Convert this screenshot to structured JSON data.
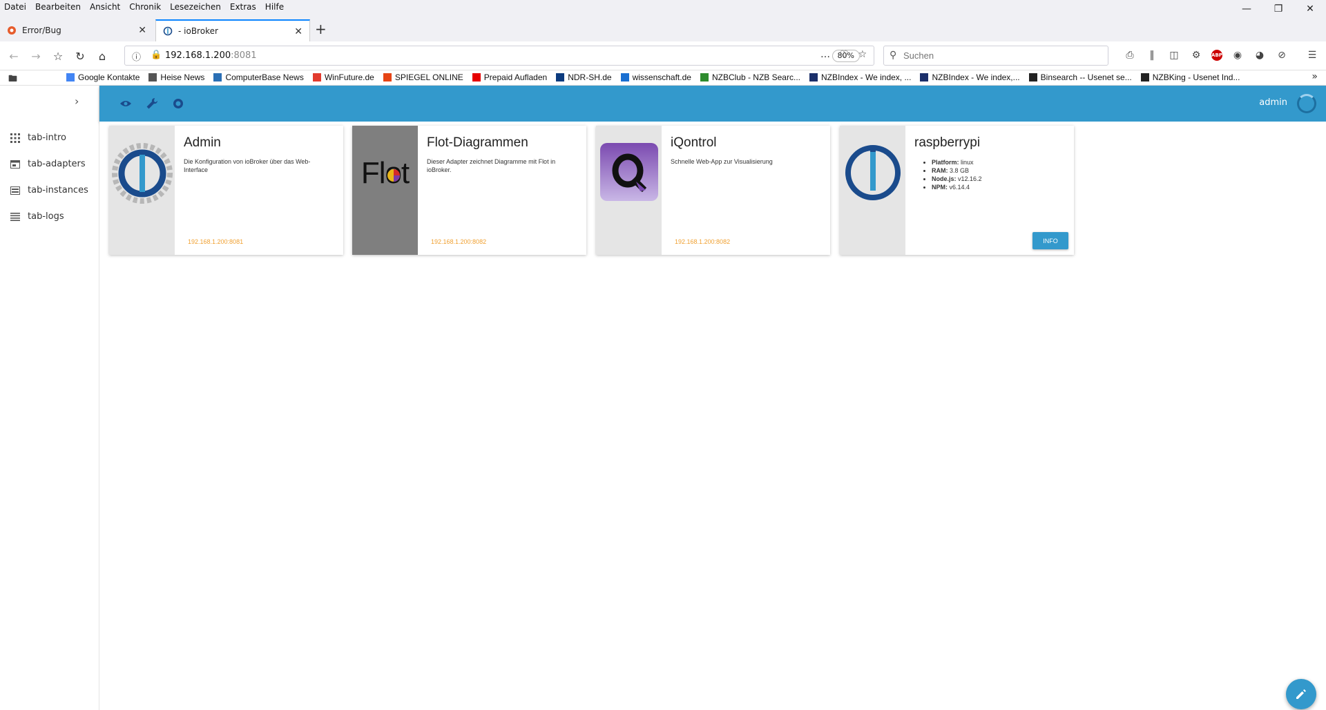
{
  "browser": {
    "menu": [
      "Datei",
      "Bearbeiten",
      "Ansicht",
      "Chronik",
      "Lesezeichen",
      "Extras",
      "Hilfe"
    ],
    "tabs": [
      {
        "label": "Error/Bug",
        "active": false
      },
      {
        "label": "- ioBroker",
        "active": true
      }
    ],
    "url": {
      "host": "192.168.1.200",
      "port": ":8081"
    },
    "zoom": "80%",
    "search_placeholder": "Suchen",
    "bookmarks": [
      {
        "label": "Google Kontakte",
        "icon": "google-icon",
        "color": "#4285f4"
      },
      {
        "label": "Heise News",
        "icon": "heise-icon",
        "color": "#555555"
      },
      {
        "label": "ComputerBase News",
        "icon": "computerbase-icon",
        "color": "#2a6fb5"
      },
      {
        "label": "WinFuture.de",
        "icon": "winfuture-icon",
        "color": "#e23b2e"
      },
      {
        "label": "SPIEGEL ONLINE",
        "icon": "spiegel-icon",
        "color": "#e64415"
      },
      {
        "label": "Prepaid Aufladen",
        "icon": "vodafone-icon",
        "color": "#e60000"
      },
      {
        "label": "NDR-SH.de",
        "icon": "ndr-icon",
        "color": "#0c3b7e"
      },
      {
        "label": "wissenschaft.de",
        "icon": "bdw-icon",
        "color": "#1a6fd1"
      },
      {
        "label": "NZBClub - NZB Searc...",
        "icon": "nzbclub-icon",
        "color": "#2e8b2e"
      },
      {
        "label": "NZBIndex - We index, ...",
        "icon": "nzbindex-icon",
        "color": "#1b2f6a"
      },
      {
        "label": "NZBIndex - We index,...",
        "icon": "nzbindex-icon",
        "color": "#1b2f6a"
      },
      {
        "label": "Binsearch -- Usenet se...",
        "icon": "binsearch-icon",
        "color": "#222222"
      },
      {
        "label": "NZBKing - Usenet Ind...",
        "icon": "nzbking-icon",
        "color": "#222222"
      }
    ]
  },
  "app": {
    "sidebar": [
      {
        "label": "tab-intro",
        "icon": "grid-icon"
      },
      {
        "label": "tab-adapters",
        "icon": "adapter-icon"
      },
      {
        "label": "tab-instances",
        "icon": "instances-icon"
      },
      {
        "label": "tab-logs",
        "icon": "list-icon"
      }
    ],
    "user": "admin",
    "accent": "#3399cc",
    "cards": [
      {
        "title": "Admin",
        "desc": "Die Konfiguration von ioBroker über das Web-Interface",
        "link": "192.168.1.200:8081"
      },
      {
        "title": "Flot-Diagrammen",
        "desc": "Dieser Adapter zeichnet Diagramme mit Flot in ioBroker.",
        "link": "192.168.1.200:8082",
        "logo_text": "Flot"
      },
      {
        "title": "iQontrol",
        "desc": "Schnelle Web-App zur Visualisierung",
        "link": "192.168.1.200:8082"
      },
      {
        "title": "raspberrypi",
        "info": [
          {
            "k": "Platform:",
            "v": "linux"
          },
          {
            "k": "RAM:",
            "v": "3.8 GB"
          },
          {
            "k": "Node.js:",
            "v": "v12.16.2"
          },
          {
            "k": "NPM:",
            "v": "v6.14.4"
          }
        ],
        "button": "INFO"
      }
    ]
  }
}
